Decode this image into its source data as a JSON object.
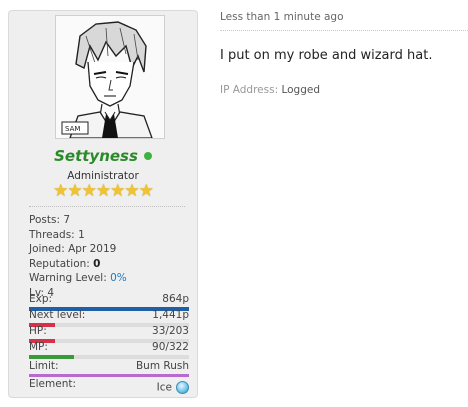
{
  "post": {
    "timestamp": "Less than 1 minute ago",
    "message": "I put on my robe and wizard hat.",
    "ip_label": "IP Address:",
    "ip_value": "Logged"
  },
  "user": {
    "name": "Settyness",
    "title": "Administrator",
    "stars": "★★★★★★★",
    "online_status": "online",
    "avatar_text": "SAM"
  },
  "stats": {
    "posts_label": "Posts:",
    "posts": "7",
    "threads_label": "Threads:",
    "threads": "1",
    "joined_label": "Joined:",
    "joined": "Apr 2019",
    "reputation_label": "Reputation:",
    "reputation": "0",
    "warning_label": "Warning Level:",
    "warning": "0%",
    "level_label": "Lv:",
    "level": "4"
  },
  "rpg": {
    "exp": {
      "label": "Exp:",
      "value": "864p",
      "fraction": 1.0,
      "color": "#1f5fa8"
    },
    "next": {
      "label": "Next level:",
      "value": "1,441p",
      "fraction": 0.16,
      "color": "#d9304a"
    },
    "hp": {
      "label": "HP:",
      "value": "33/203",
      "fraction": 0.16,
      "color": "#d9304a"
    },
    "mp": {
      "label": "MP:",
      "value": "90/322",
      "fraction": 0.28,
      "color": "#3a9a3a"
    },
    "limit": {
      "label": "Limit:",
      "value": "Bum Rush",
      "color": "#b96ad0"
    },
    "element": {
      "label": "Element:",
      "value": "Ice",
      "icon": "ice-orb-icon"
    }
  }
}
